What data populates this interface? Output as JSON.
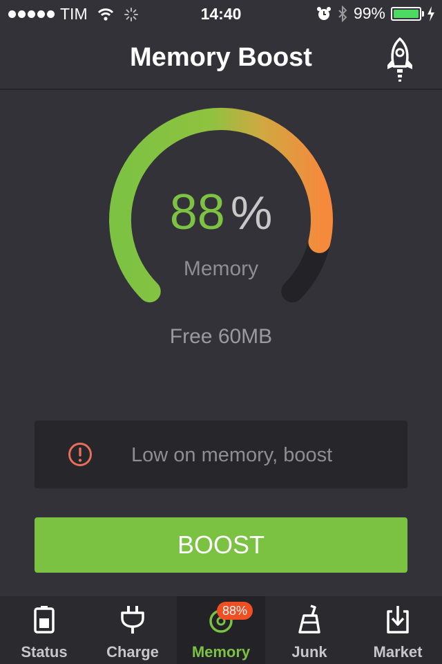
{
  "status_bar": {
    "carrier": "TIM",
    "time": "14:40",
    "battery_percent": "99%",
    "battery_level": 0.99
  },
  "nav": {
    "title": "Memory Boost",
    "action_icon": "rocket-icon"
  },
  "gauge": {
    "value": "88",
    "unit": "%",
    "label": "Memory",
    "fraction": 0.88,
    "colors": {
      "start": "#7dc243",
      "end": "#f58a3c",
      "track": "#232327"
    }
  },
  "free_memory": "Free 60MB",
  "warning": {
    "icon": "alert-circle-icon",
    "text": "Low on memory, boost",
    "icon_color": "#e8705a"
  },
  "boost_button": {
    "label": "BOOST",
    "color": "#7bc142"
  },
  "tabs": [
    {
      "label": "Status",
      "icon": "battery-icon",
      "active": false
    },
    {
      "label": "Charge",
      "icon": "plug-icon",
      "active": false
    },
    {
      "label": "Memory",
      "icon": "memory-gauge-icon",
      "active": true,
      "badge": "88%"
    },
    {
      "label": "Junk",
      "icon": "broom-icon",
      "active": false
    },
    {
      "label": "Market",
      "icon": "download-icon",
      "active": false
    }
  ]
}
